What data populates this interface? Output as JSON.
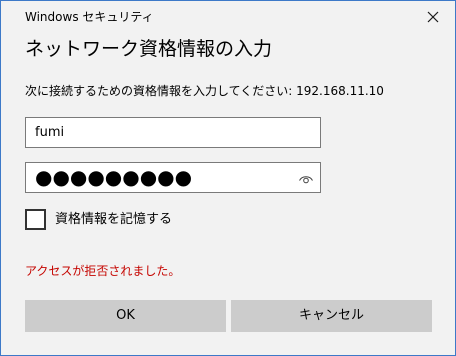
{
  "window": {
    "title": "Windows セキュリティ",
    "close_icon": "close-icon",
    "border_color": "#3d79c8"
  },
  "dialog": {
    "heading": "ネットワーク資格情報の入力",
    "message": "次に接続するための資格情報を入力してください: 192.168.11.10",
    "username": {
      "value": "fumi"
    },
    "password": {
      "masked_value": "●●●●●●●●●",
      "reveal_icon": "eye-icon"
    },
    "remember": {
      "label": "資格情報を記憶する",
      "checked": false
    },
    "error": {
      "text": "アクセスが拒否されました。",
      "color": "#c50500"
    },
    "buttons": {
      "ok_label": "OK",
      "cancel_label": "キャンセル"
    }
  }
}
